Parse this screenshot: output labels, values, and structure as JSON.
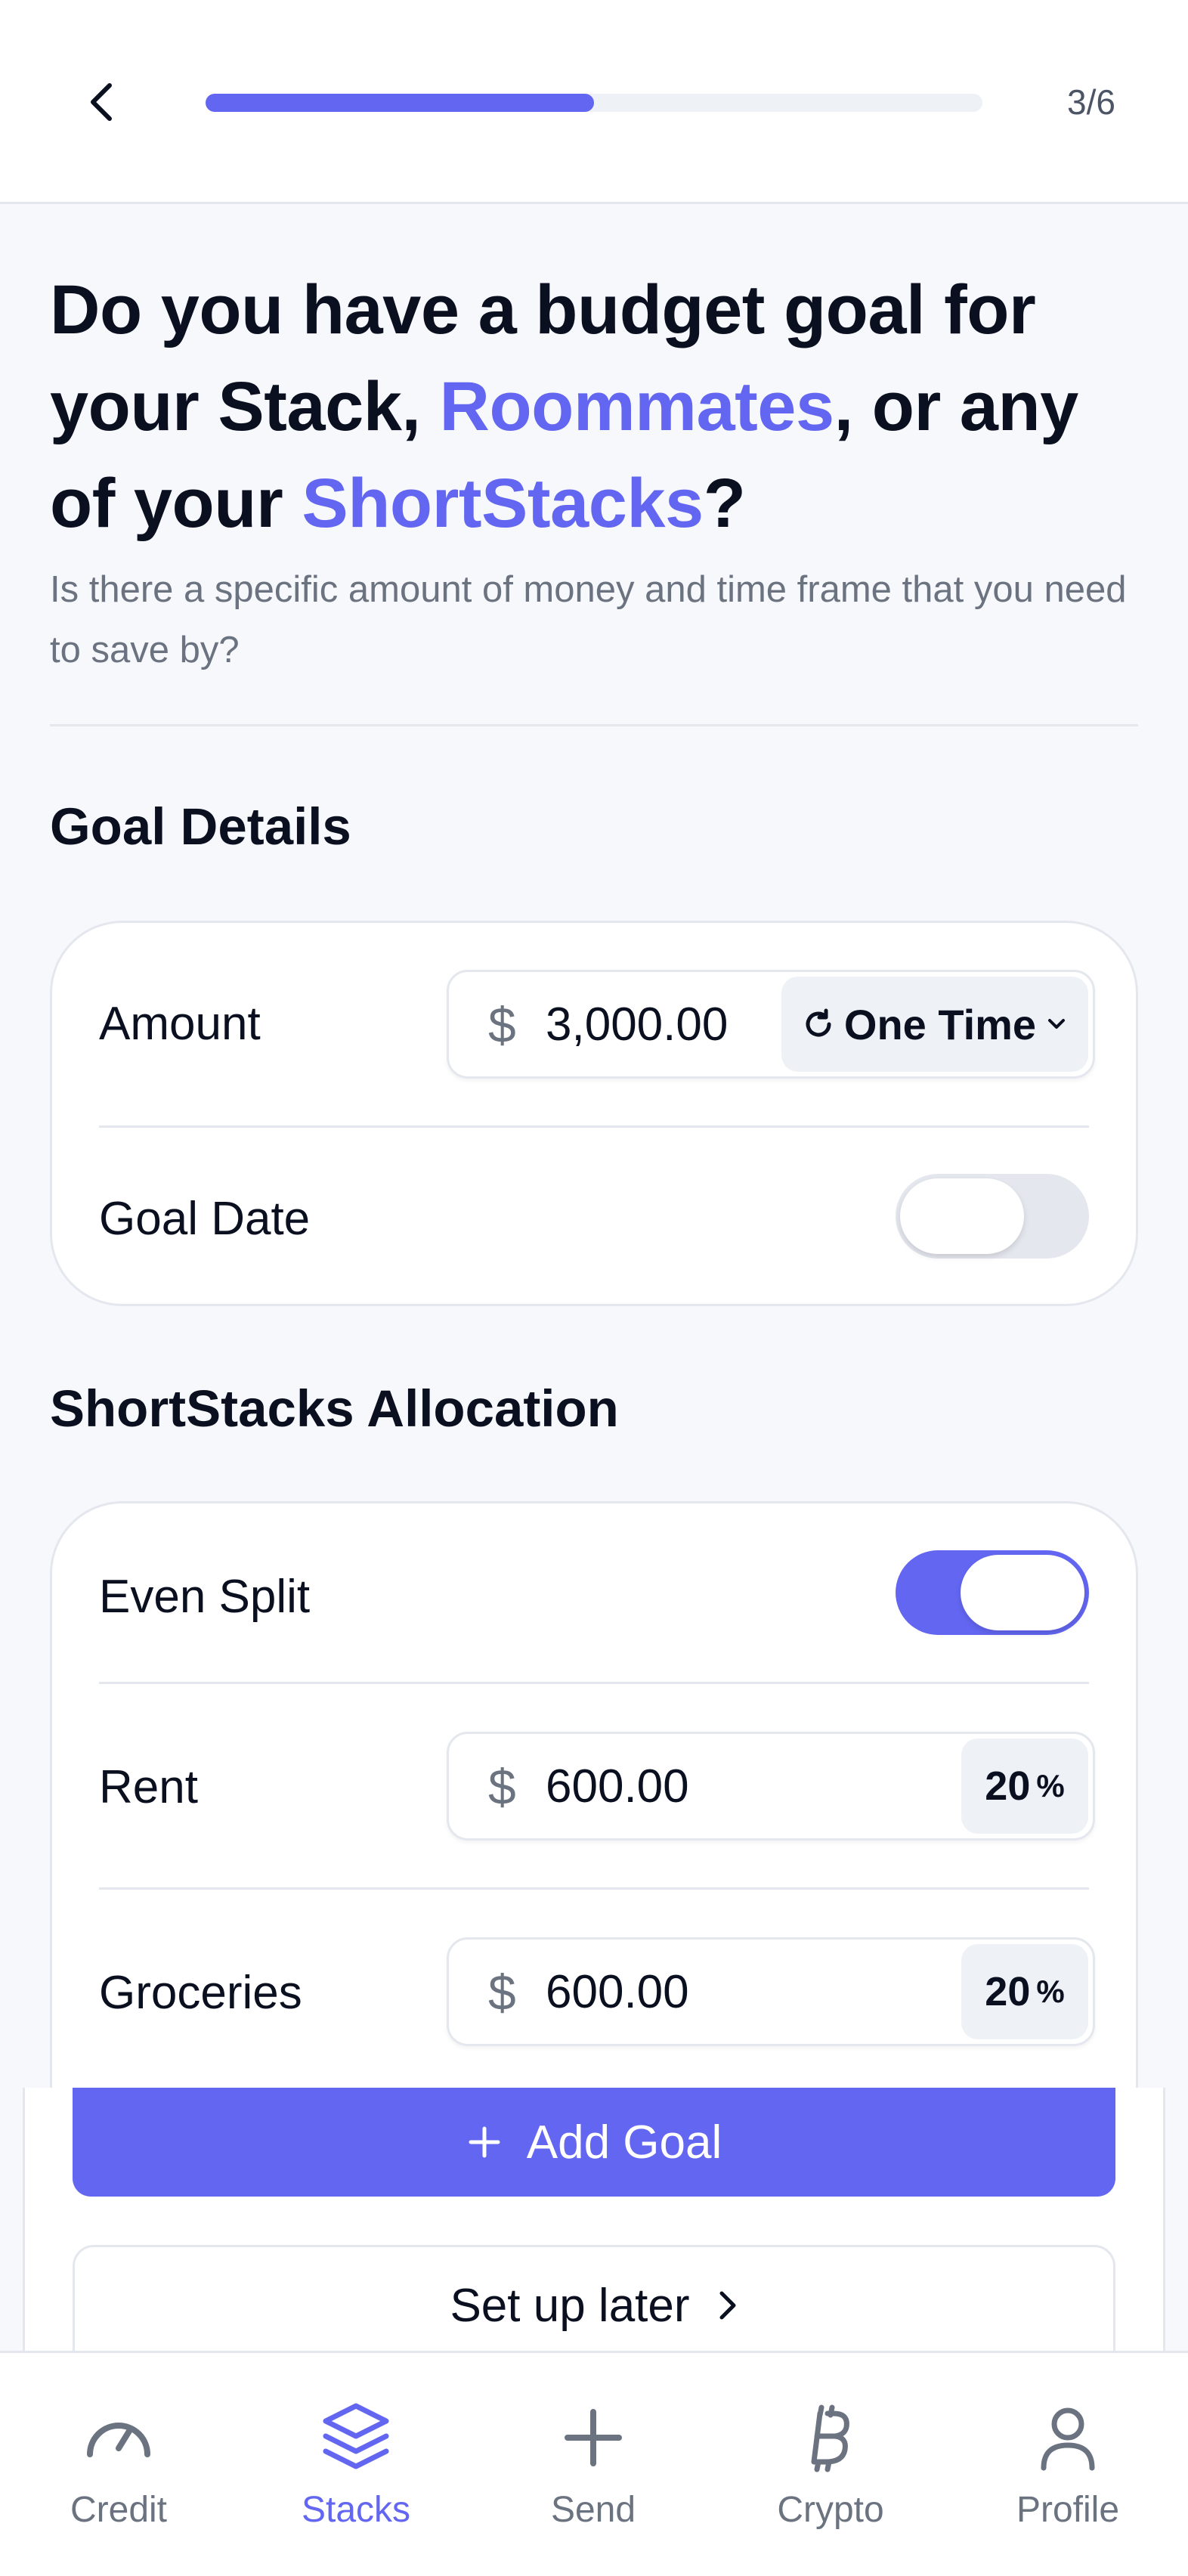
{
  "header": {
    "back_icon": "chevron-left-icon",
    "step_label": "3/6",
    "progress": 0.5
  },
  "question": {
    "part1": "Do you have a budget goal for your Stack, ",
    "highlight1": "Roommates",
    "part2": ", or any of your ",
    "highlight2": "ShortStacks",
    "part3": "?",
    "subtitle": "Is there a specific amount of money and time frame that you need to save by?"
  },
  "goal_details": {
    "title": "Goal Details",
    "amount_label": "Amount",
    "currency_symbol": "$",
    "amount_value": "3,000.00",
    "frequency": "One Time",
    "frequency_icon": "refresh-icon",
    "goal_date_label": "Goal Date",
    "goal_date_enabled": false
  },
  "allocation": {
    "title": "ShortStacks Allocation",
    "even_split_label": "Even Split",
    "even_split_enabled": true,
    "items": [
      {
        "label": "Rent",
        "currency_symbol": "$",
        "amount": "600.00",
        "percent": "20",
        "percent_sign": "%"
      },
      {
        "label": "Groceries",
        "currency_symbol": "$",
        "amount": "600.00",
        "percent": "20",
        "percent_sign": "%"
      }
    ]
  },
  "actions": {
    "add_goal_label": "Add Goal",
    "add_goal_icon": "plus-icon",
    "setup_later_label": "Set up later",
    "setup_later_icon": "chevron-right-icon"
  },
  "tabbar": {
    "active": "Stacks",
    "tabs": [
      {
        "label": "Credit",
        "icon": "gauge-icon"
      },
      {
        "label": "Stacks",
        "icon": "layers-icon"
      },
      {
        "label": "Send",
        "icon": "plus-icon"
      },
      {
        "label": "Crypto",
        "icon": "bitcoin-icon"
      },
      {
        "label": "Profile",
        "icon": "user-icon"
      }
    ]
  },
  "colors": {
    "accent": "#6366F1",
    "text_primary": "#0B1020",
    "text_muted": "#6B7280",
    "border": "#E4E7EE",
    "background": "#F7F8FB"
  }
}
